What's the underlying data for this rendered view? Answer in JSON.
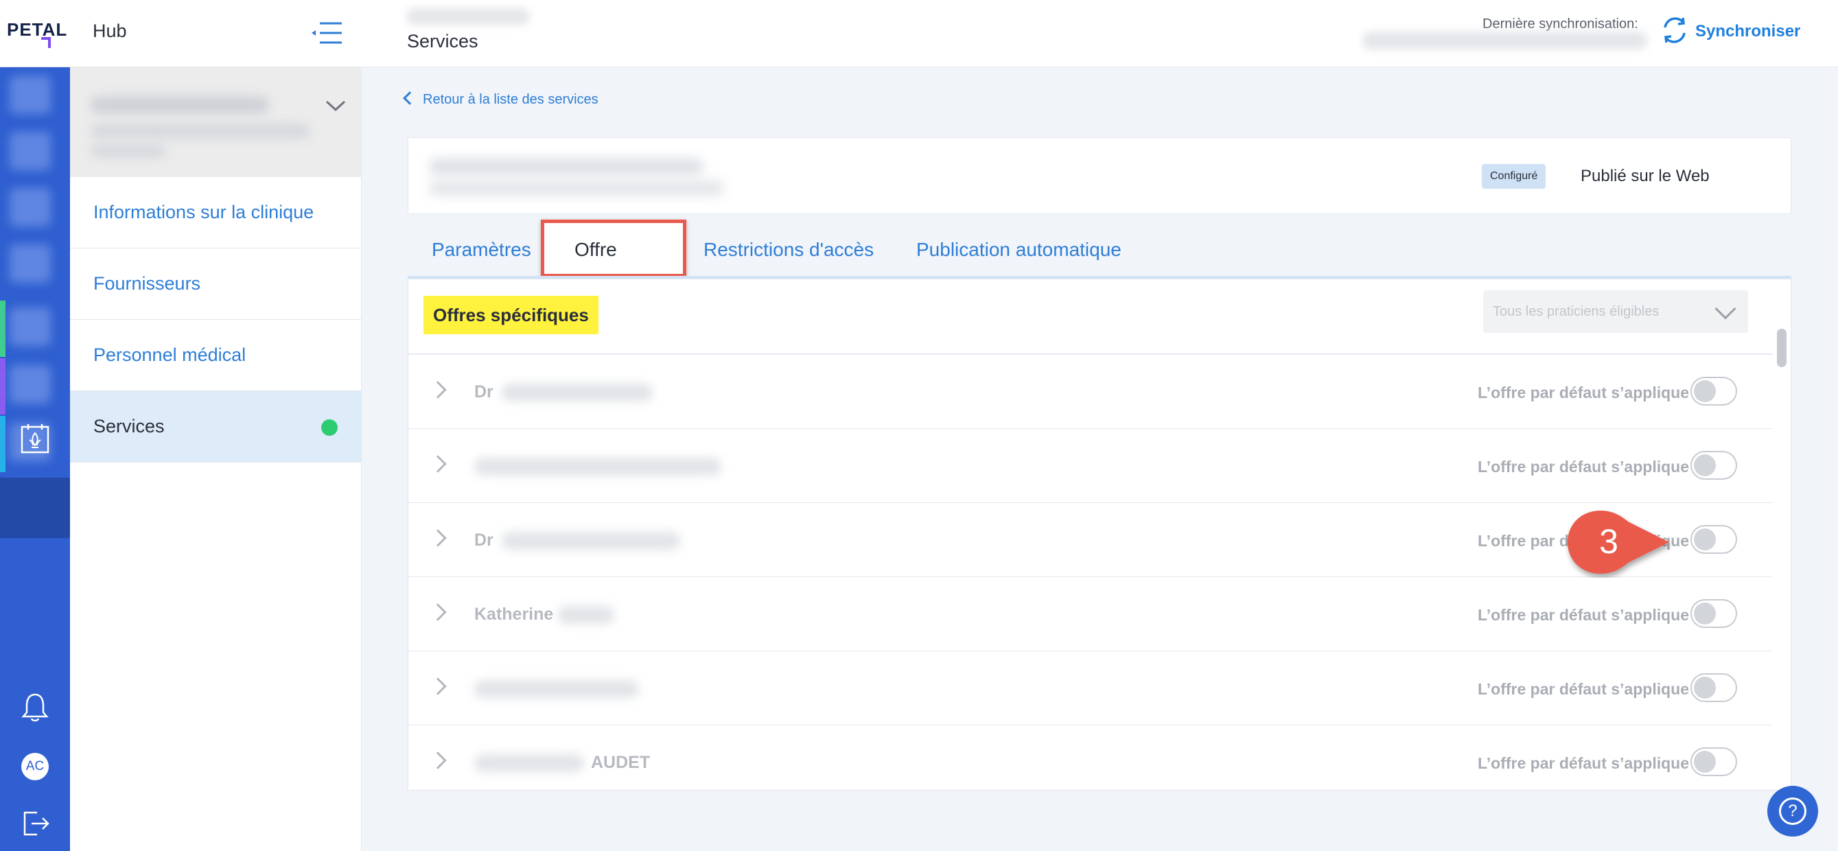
{
  "app": {
    "logo": "PETAL",
    "title": "Hub"
  },
  "header": {
    "page_title": "Services",
    "sync_label": "Dernière synchronisation:",
    "sync_button": "Synchroniser"
  },
  "rail": {
    "avatar_initials": "AC"
  },
  "sidebar": {
    "items": [
      {
        "label": "Informations sur la clinique"
      },
      {
        "label": "Fournisseurs"
      },
      {
        "label": "Personnel médical"
      },
      {
        "label": "Services"
      }
    ]
  },
  "main": {
    "back_link": "Retour à la liste des services",
    "service": {
      "status_badge": "Configuré",
      "published_label": "Publié sur le Web"
    },
    "tabs": [
      {
        "label": "Paramètres"
      },
      {
        "label": "Offre"
      },
      {
        "label": "Restrictions d'accès"
      },
      {
        "label": "Publication automatique"
      }
    ],
    "offers": {
      "title": "Offres spécifiques",
      "filter_value": "Tous les praticiens éligibles",
      "rows": [
        {
          "name": "Dr",
          "default_label": "L’offre par défaut s’applique",
          "enabled": false
        },
        {
          "name": "",
          "default_label": "L’offre par défaut s’applique",
          "enabled": false
        },
        {
          "name": "Dr",
          "default_label": "L’offre par défaut s’applique",
          "enabled": false
        },
        {
          "name": "Katherine",
          "default_label": "L’offre par défaut s’applique",
          "enabled": false
        },
        {
          "name": "",
          "default_label": "L’offre par défaut s’applique",
          "enabled": false
        },
        {
          "name": "AUDET",
          "default_label": "L’offre par défaut s’applique",
          "enabled": false
        }
      ]
    },
    "callout_number": "3"
  },
  "colors": {
    "accent": "#2e7ed6",
    "rail": "#2f5fd0",
    "highlight": "#fff23f",
    "callout": "#e95a4c",
    "status_ok": "#2ecc71"
  },
  "icons": [
    "collapse-menu-icon",
    "sync-icon",
    "chevron-down-icon",
    "calendar-icon",
    "bell-icon",
    "logout-icon",
    "chevron-right-icon",
    "help-icon"
  ]
}
